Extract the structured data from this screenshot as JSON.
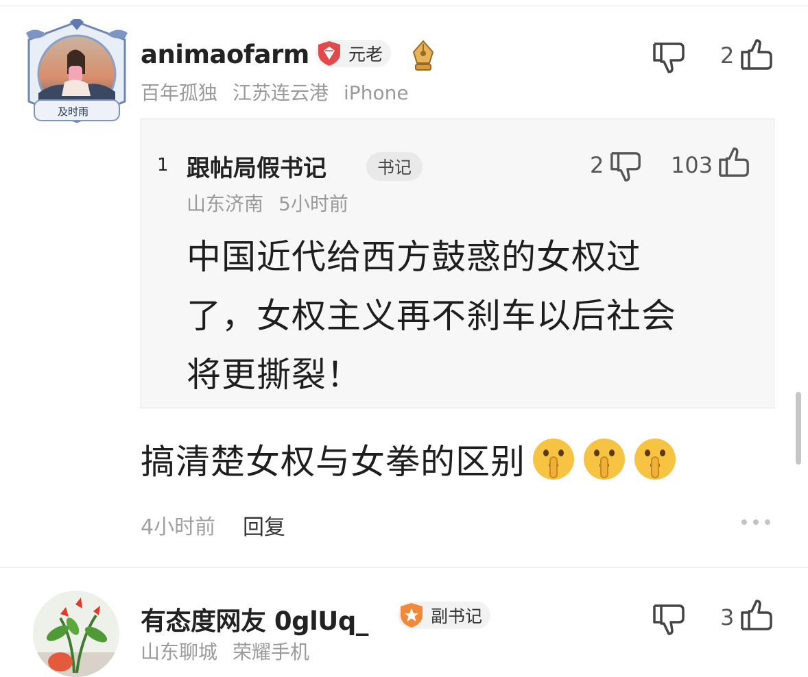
{
  "comments": [
    {
      "username": "animaofarm",
      "badge_label": "元老",
      "badge_color": "#e04a4a",
      "avatar_caption": "及时雨",
      "meta": [
        "百年孤独",
        "江苏连云港",
        "iPhone"
      ],
      "dislike_count": "",
      "like_count": "2",
      "quote": {
        "index": "1",
        "username": "跟帖局假书记",
        "badge_label": "书记",
        "meta": [
          "山东济南",
          "5小时前"
        ],
        "dislike_count": "2",
        "like_count": "103",
        "text": "中国近代给西方鼓惑的女权过了，女权主义再不刹车以后社会将更撕裂！"
      },
      "text": "搞清楚女权与女拳的区别",
      "emojis": [
        "shushing-face",
        "shushing-face",
        "shushing-face"
      ],
      "time": "4小时前",
      "reply_label": "回复"
    },
    {
      "username": "有态度网友 0glUq_",
      "badge_label": "副书记",
      "badge_color": "#f08a3a",
      "meta": [
        "山东聊城",
        "荣耀手机"
      ],
      "like_count": "3"
    }
  ]
}
